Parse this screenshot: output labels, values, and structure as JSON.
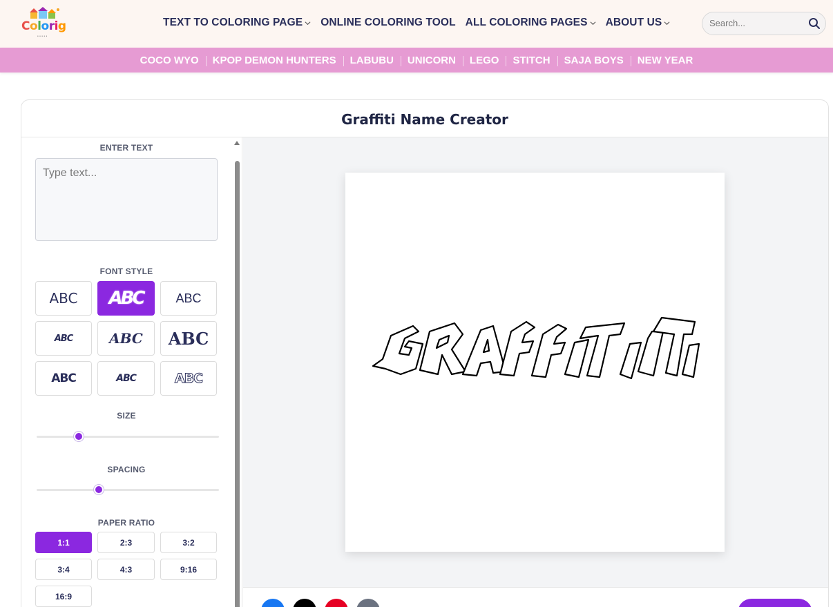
{
  "brand": {
    "logo_text": "Colorig"
  },
  "nav": {
    "items": [
      {
        "label": "TEXT TO COLORING PAGE",
        "has_dropdown": true
      },
      {
        "label": "ONLINE COLORING TOOL",
        "has_dropdown": false
      },
      {
        "label": "ALL COLORING PAGES",
        "has_dropdown": true
      },
      {
        "label": "ABOUT US",
        "has_dropdown": true
      }
    ]
  },
  "search": {
    "placeholder": "Search..."
  },
  "categories": [
    "COCO WYO",
    "KPOP DEMON HUNTERS",
    "LABUBU",
    "UNICORN",
    "LEGO",
    "STITCH",
    "SAJA BOYS",
    "NEW YEAR"
  ],
  "tool": {
    "title": "Graffiti Name Creator",
    "enter_text_label": "ENTER TEXT",
    "text_placeholder": "Type text...",
    "font_style_label": "FONT STYLE",
    "font_styles": [
      "ABC",
      "ABC",
      "ABC",
      "ABC",
      "ABC",
      "ABC",
      "ABC",
      "ABC",
      "ABC"
    ],
    "selected_font_index": 1,
    "size_label": "SIZE",
    "size_value": 0.23,
    "spacing_label": "SPACING",
    "spacing_value": 0.34,
    "paper_ratio_label": "PAPER RATIO",
    "ratios": [
      "1:1",
      "2:3",
      "3:2",
      "3:4",
      "4:3",
      "9:16",
      "16:9"
    ],
    "selected_ratio": "1:1"
  },
  "colors": {
    "accent": "#8b28e0",
    "category_bar": "#e69bd3",
    "nav_text": "#2a2e5a"
  }
}
